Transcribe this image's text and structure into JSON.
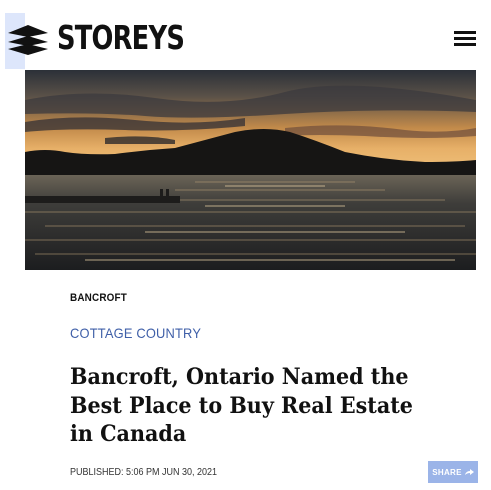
{
  "header": {
    "logo_text": "STOREYS"
  },
  "hero": {
    "icon": "lake-sunset-image"
  },
  "article": {
    "category": "BANCROFT",
    "section": "COTTAGE COUNTRY",
    "headline": "Bancroft, Ontario Named the Best Place to Buy Real Estate in Canada",
    "published": "PUBLISHED: 5:06 PM JUN 30, 2021",
    "share_label": "SHARE"
  },
  "colors": {
    "accent": "#3f5fa8",
    "share_button": "#9bb4e8",
    "logo_highlight": "#dde6fb"
  }
}
